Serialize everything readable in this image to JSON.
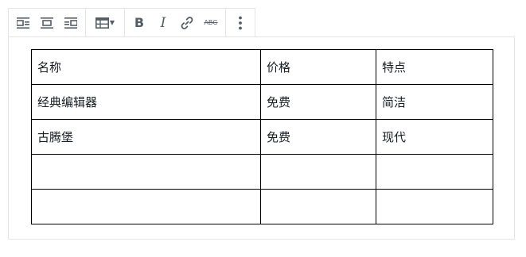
{
  "toolbar": {
    "alignment": [
      "align-left-icon",
      "align-center-icon",
      "align-right-icon"
    ],
    "table_menu": "table-icon",
    "formatting": [
      "bold-icon",
      "italic-icon",
      "link-icon",
      "strikethrough-icon"
    ],
    "more": "more-vertical-icon",
    "bold_glyph": "B",
    "italic_glyph": "I",
    "strike_glyph": "ABC"
  },
  "table": {
    "rows": [
      [
        "名称",
        "价格",
        "特点"
      ],
      [
        "经典编辑器",
        "免费",
        "简洁"
      ],
      [
        "古腾堡",
        "免费",
        "现代"
      ],
      [
        "",
        "",
        ""
      ],
      [
        "",
        "",
        ""
      ]
    ]
  }
}
